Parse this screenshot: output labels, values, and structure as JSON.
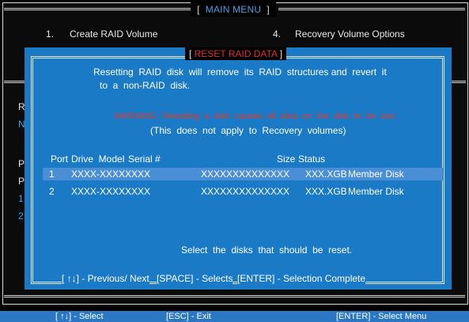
{
  "header": {
    "bracket_left": "[",
    "title": "MAIN MENU",
    "bracket_right": "]"
  },
  "main_menu": {
    "item1": "1.",
    "item1_label": "Create RAID Volume",
    "item4": "4.",
    "item4_label": "Recovery Volume Options"
  },
  "background_partial": {
    "r": "R",
    "n": "N",
    "p1": "P",
    "p2": "P",
    "n1": "1",
    "n2": "2"
  },
  "dialog": {
    "title_bracket_left": "[",
    "title": "RESET RAID DATA",
    "title_bracket_right": "]",
    "message_line1": "Resetting  RAID  disk  will  remove  its  RAID  structures and  revert  it",
    "message_line2": "to  a  non-RAID  disk.",
    "warning": "WARNING : Resetting  a  disk  causes  all  data  on  the  disk  to  be  lost.",
    "note": "(This  does  not  apply  to  Recovery  volumes)",
    "columns": {
      "port": "Port",
      "drive_model": "Drive  Model",
      "serial": "Serial #",
      "size": "Size",
      "status": "Status"
    },
    "disks": [
      {
        "port": "1",
        "model": "XXXX-XXXXXXXX",
        "serial": "XXXXXXXXXXXXXX",
        "size": "XXX.XGB",
        "status": "Member Disk"
      },
      {
        "port": "2",
        "model": "XXXX-XXXXXXXX",
        "serial": "XXXXXXXXXXXXXX",
        "size": "XXX.XGB",
        "status": "Member Disk"
      }
    ],
    "prompt": "Select  the  disks  that  should  be  reset.",
    "help_nav": "[ ↑↓] - Previous/ Next",
    "help_space": "[SPACE] - Selects",
    "help_enter": "[ENTER] - Selection Complete"
  },
  "footer": {
    "select": "[ ↑↓] - Select",
    "exit": "[ESC] - Exit",
    "enter": "[ENTER] - Select Menu"
  }
}
